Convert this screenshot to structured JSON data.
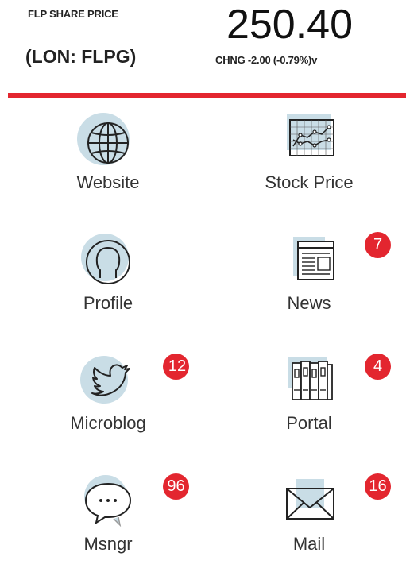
{
  "header": {
    "share_label": "FLP SHARE PRICE",
    "ticker": "(LON: FLPG)",
    "price": "250.40",
    "change": "CHNG -2.00 (-0.79%)v"
  },
  "colors": {
    "accent": "#e3262f",
    "icon_bg": "#c9dde6",
    "icon_stroke": "#222222"
  },
  "tiles": [
    {
      "label": "Website",
      "icon": "globe-icon",
      "badge": ""
    },
    {
      "label": "Stock Price",
      "icon": "chart-icon",
      "badge": ""
    },
    {
      "label": "Profile",
      "icon": "user-icon",
      "badge": ""
    },
    {
      "label": "News",
      "icon": "newspaper-icon",
      "badge": "7"
    },
    {
      "label": "Microblog",
      "icon": "bird-icon",
      "badge": "12"
    },
    {
      "label": "Portal",
      "icon": "binders-icon",
      "badge": "4"
    },
    {
      "label": "Msngr",
      "icon": "chat-bubble-icon",
      "badge": "96"
    },
    {
      "label": "Mail",
      "icon": "envelope-icon",
      "badge": "16"
    }
  ]
}
